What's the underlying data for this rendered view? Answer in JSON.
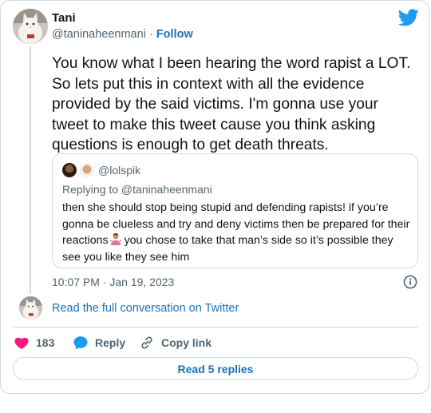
{
  "tweet": {
    "author_name": "Tani",
    "author_handle": "@taninaheenmani",
    "separator": "·",
    "follow_label": "Follow",
    "text": "You know what I been hearing the word rapist a LOT. So lets put this in context with all the evidence provided by the said victims. I'm gonna use your tweet to make this tweet cause you think asking questions is enough to get death threats.",
    "timestamp": "10:07 PM · Jan 19, 2023"
  },
  "quoted_tweet": {
    "handle": "@lolspik",
    "replying_to": "Replying to @taninaheenmani",
    "text_before_emoji": "then she should stop being stupid and defending rapists! if you’re gonna be clueless and try and deny victims then be prepared for their reactions",
    "emoji": "person-shrugging-emoji",
    "text_after_emoji": "you chose to take that man’s side so it’s possible they see you like they see him"
  },
  "conversation": {
    "read_full_label": "Read the full conversation on Twitter"
  },
  "actions": {
    "like_count": "183",
    "reply_label": "Reply",
    "copy_link_label": "Copy link"
  },
  "footer": {
    "read_replies_label": "Read 5 replies"
  },
  "icons": {
    "brand": "twitter-bird-icon",
    "info": "info-icon",
    "like": "heart-icon",
    "reply": "speech-bubble-icon",
    "copy": "link-icon"
  },
  "colors": {
    "brand_blue": "#1d9bf0",
    "link_blue": "#1d70b8",
    "like_pink": "#f91880",
    "secondary_text": "#536471",
    "border": "#cfd9de"
  }
}
